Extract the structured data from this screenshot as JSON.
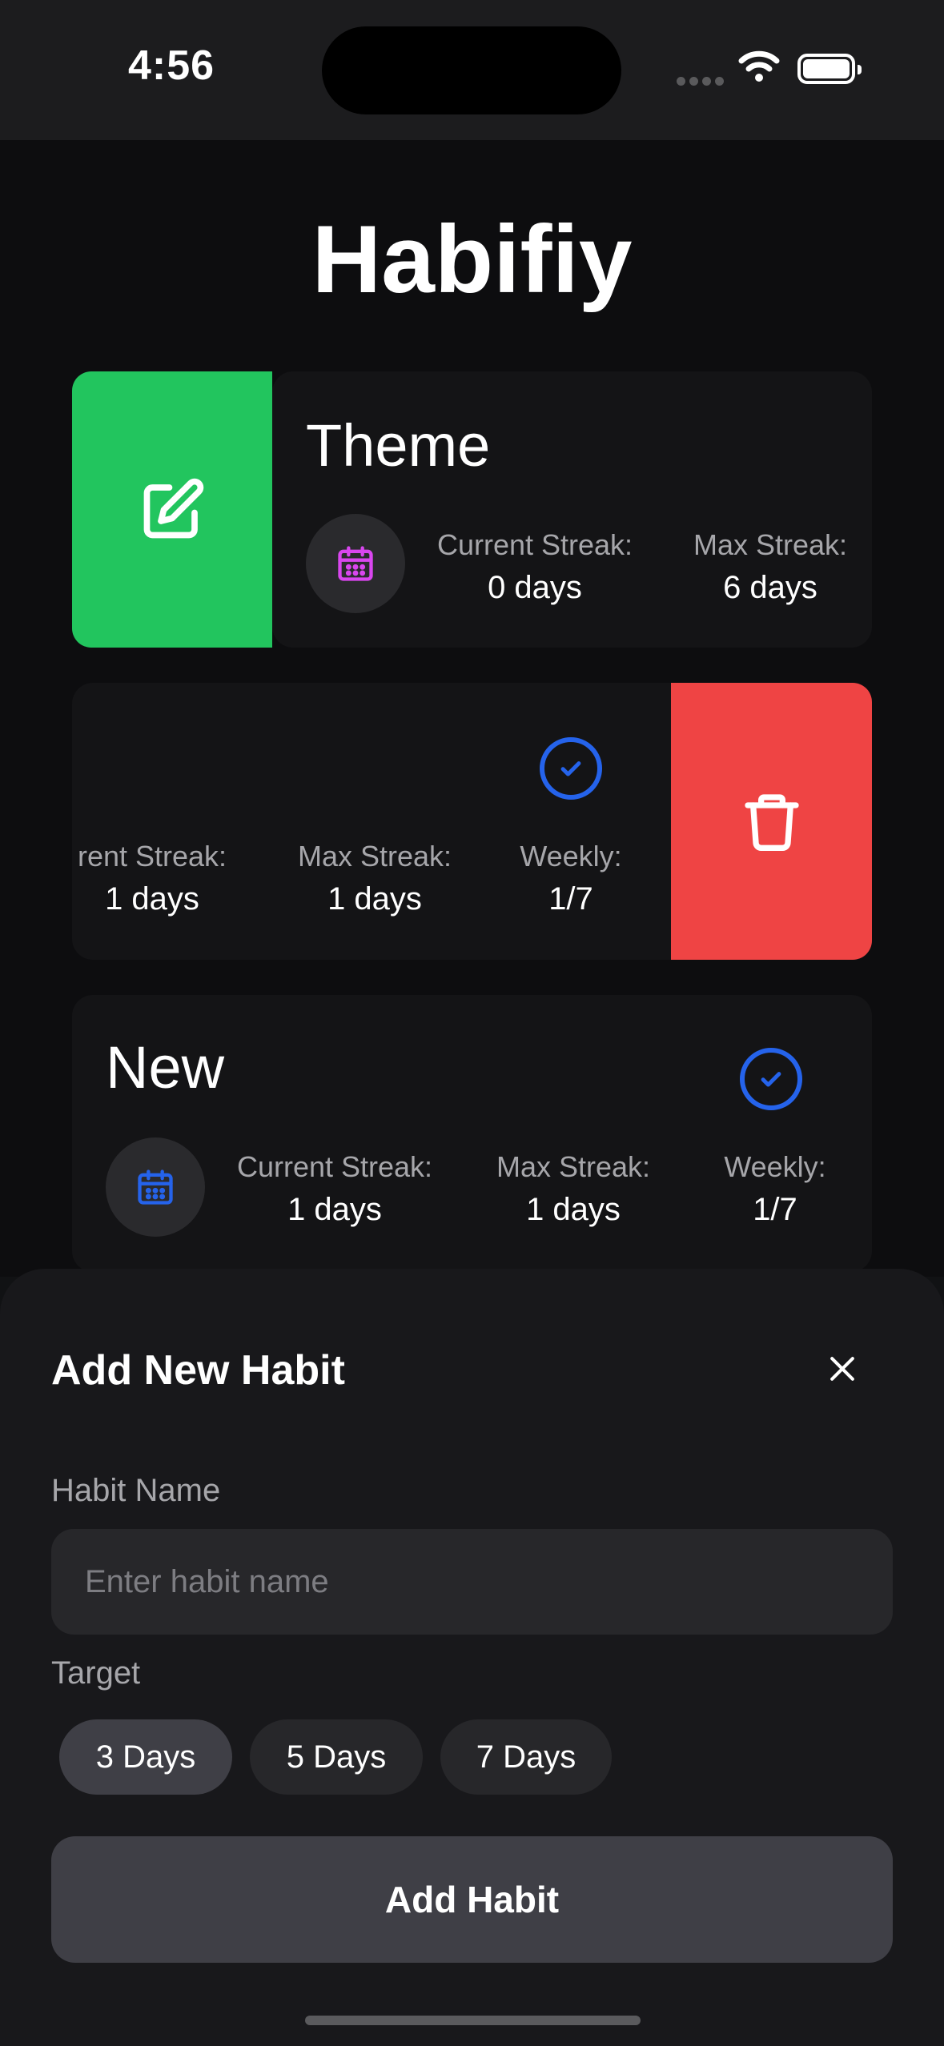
{
  "status_bar": {
    "time": "4:56"
  },
  "app": {
    "title": "Habifiy"
  },
  "habits": [
    {
      "name": "Theme",
      "current_streak_label": "Current Streak:",
      "current_streak_value": "0 days",
      "max_streak_label": "Max Streak:",
      "max_streak_value": "6 days",
      "icon_color": "#d946ef"
    },
    {
      "current_streak_label": "rent Streak:",
      "current_streak_value": "1 days",
      "max_streak_label": "Max Streak:",
      "max_streak_value": "1 days",
      "weekly_label": "Weekly:",
      "weekly_value": "1/7"
    },
    {
      "name": "New",
      "current_streak_label": "Current Streak:",
      "current_streak_value": "1 days",
      "max_streak_label": "Max Streak:",
      "max_streak_value": "1 days",
      "weekly_label": "Weekly:",
      "weekly_value": "1/7",
      "icon_color": "#2563eb"
    }
  ],
  "swipe_actions": {
    "edit_color": "#22c55e",
    "delete_color": "#ef4444"
  },
  "sheet": {
    "title": "Add New Habit",
    "habit_name_label": "Habit Name",
    "habit_name_placeholder": "Enter habit name",
    "habit_name_value": "",
    "target_label": "Target",
    "target_options": [
      "3 Days",
      "5 Days",
      "7 Days"
    ],
    "selected_target": "3 Days",
    "submit_label": "Add Habit"
  }
}
